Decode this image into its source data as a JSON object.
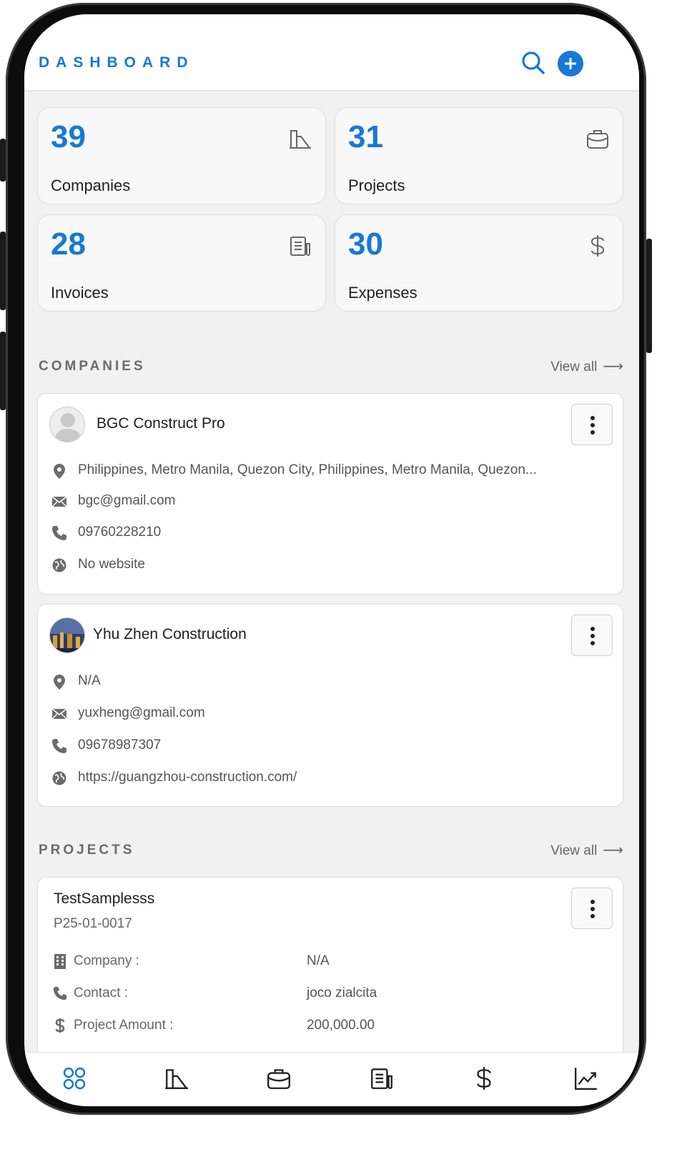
{
  "header": {
    "title": "DASHBOARD"
  },
  "stats": [
    {
      "value": "39",
      "label": "Companies",
      "icon": "building-icon"
    },
    {
      "value": "31",
      "label": "Projects",
      "icon": "briefcase-icon"
    },
    {
      "value": "28",
      "label": "Invoices",
      "icon": "invoice-icon"
    },
    {
      "value": "30",
      "label": "Expenses",
      "icon": "dollar-icon"
    }
  ],
  "companies_section": {
    "title": "COMPANIES",
    "view_all": "View all",
    "items": [
      {
        "name": "BGC Construct Pro",
        "address": "Philippines, Metro Manila, Quezon City, Philippines, Metro Manila, Quezon...",
        "email": "bgc@gmail.com",
        "phone": "09760228210",
        "website": "No website"
      },
      {
        "name": "Yhu Zhen Construction",
        "address": "N/A",
        "email": "yuxheng@gmail.com",
        "phone": "09678987307",
        "website": "https://guangzhou-construction.com/"
      }
    ]
  },
  "projects_section": {
    "title": "PROJECTS",
    "view_all": "View all",
    "items": [
      {
        "name": "TestSamplesss",
        "code": "P25-01-0017",
        "fields": [
          {
            "label": "Company :",
            "value": "N/A"
          },
          {
            "label": "Contact :",
            "value": "joco zialcita"
          },
          {
            "label": "Project Amount :",
            "value": "200,000.00"
          }
        ]
      }
    ]
  },
  "colors": {
    "accent": "#1778d6",
    "background": "#f1f1f1"
  },
  "bottom_nav": [
    "dashboard-icon",
    "building-icon",
    "briefcase-icon",
    "invoice-icon",
    "dollar-icon",
    "chart-icon"
  ]
}
